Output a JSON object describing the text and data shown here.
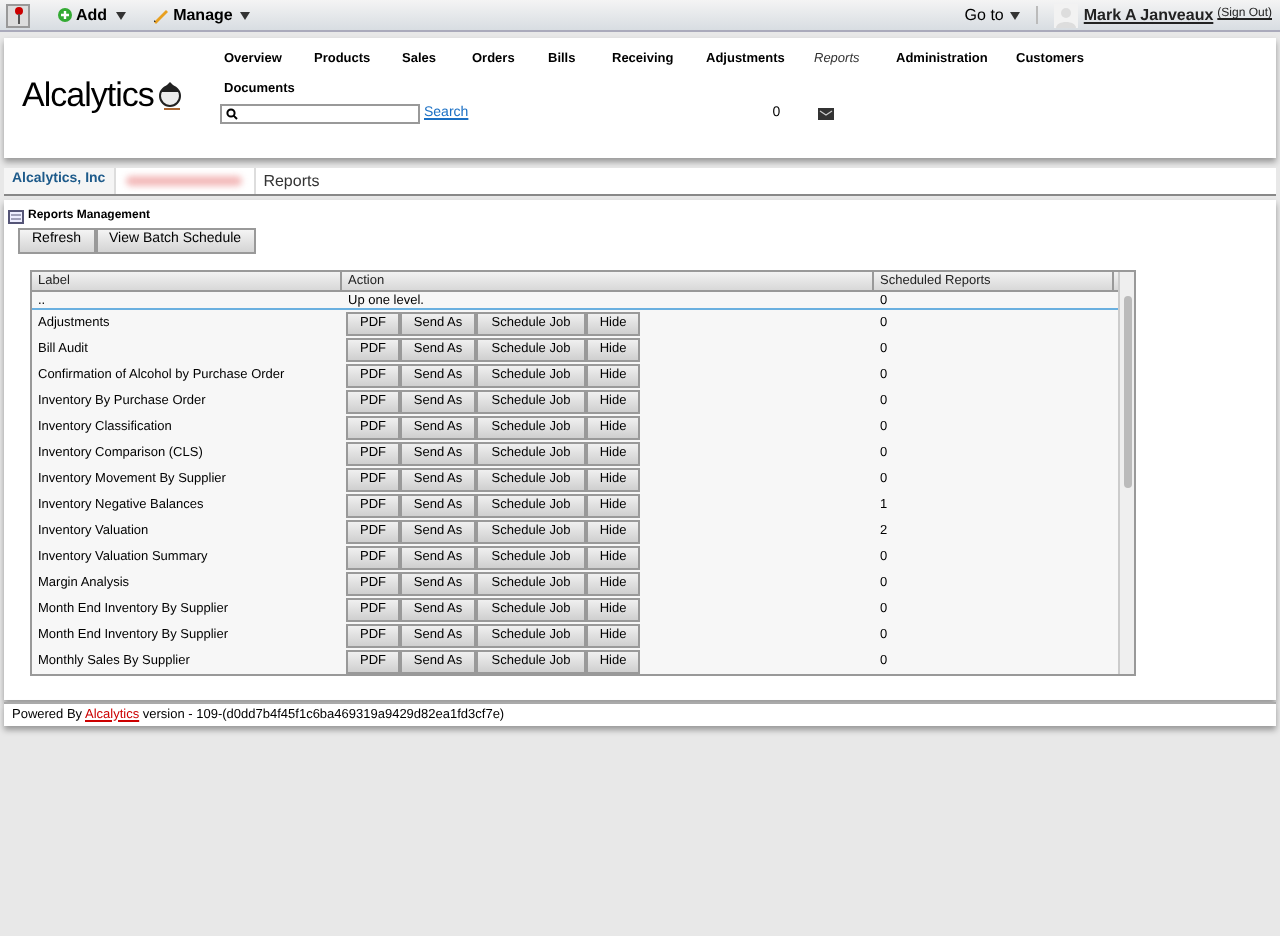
{
  "topbar": {
    "add": "Add",
    "manage": "Manage",
    "goto": "Go to",
    "user": "Mark A Janveaux",
    "sign_out": "(Sign Out)"
  },
  "header": {
    "logo": "Alcalytics",
    "search_link": "Search",
    "count": "0",
    "nav": [
      {
        "label": "Overview",
        "selected": false
      },
      {
        "label": "Products",
        "selected": false
      },
      {
        "label": "Sales",
        "selected": false
      },
      {
        "label": "Orders",
        "selected": false
      },
      {
        "label": "Bills",
        "selected": false
      },
      {
        "label": "Receiving",
        "selected": false
      },
      {
        "label": "Adjustments",
        "selected": false
      },
      {
        "label": "Reports",
        "selected": true
      },
      {
        "label": "Administration",
        "selected": false
      },
      {
        "label": "Customers",
        "selected": false
      },
      {
        "label": "Documents",
        "selected": false
      }
    ]
  },
  "breadcrumb": {
    "company": "Alcalytics, Inc",
    "current": "Reports"
  },
  "panel": {
    "title": "Reports Management",
    "buttons": [
      "Refresh",
      "View Batch Schedule"
    ]
  },
  "table": {
    "columns": [
      "Label",
      "Action",
      "Scheduled Reports"
    ],
    "up_row": {
      "label": "..",
      "action": "Up one level.",
      "count": "0"
    },
    "rows": [
      {
        "label": "Adjustments",
        "actions": [
          "PDF",
          "Send As",
          "Schedule Job",
          "Hide"
        ],
        "count": "0"
      },
      {
        "label": "Bill Audit",
        "actions": [
          "PDF",
          "Send As",
          "Schedule Job",
          "Hide"
        ],
        "count": "0"
      },
      {
        "label": "Confirmation of Alcohol by Purchase Order",
        "actions": [
          "PDF",
          "Send As",
          "Schedule Job",
          "Hide"
        ],
        "count": "0"
      },
      {
        "label": "Inventory By Purchase Order",
        "actions": [
          "PDF",
          "Send As",
          "Schedule Job",
          "Hide"
        ],
        "count": "0"
      },
      {
        "label": "Inventory Classification",
        "actions": [
          "PDF",
          "Send As",
          "Schedule Job",
          "Hide"
        ],
        "count": "0"
      },
      {
        "label": "Inventory Comparison (CLS)",
        "actions": [
          "PDF",
          "Send As",
          "Schedule Job",
          "Hide"
        ],
        "count": "0"
      },
      {
        "label": "Inventory Movement By Supplier",
        "actions": [
          "PDF",
          "Send As",
          "Schedule Job",
          "Hide"
        ],
        "count": "0"
      },
      {
        "label": "Inventory Negative Balances",
        "actions": [
          "PDF",
          "Send As",
          "Schedule Job",
          "Hide"
        ],
        "count": "1"
      },
      {
        "label": "Inventory Valuation",
        "actions": [
          "PDF",
          "Send As",
          "Schedule Job",
          "Hide"
        ],
        "count": "2"
      },
      {
        "label": "Inventory Valuation Summary",
        "actions": [
          "PDF",
          "Send As",
          "Schedule Job",
          "Hide"
        ],
        "count": "0"
      },
      {
        "label": "Margin Analysis",
        "actions": [
          "PDF",
          "Send As",
          "Schedule Job",
          "Hide"
        ],
        "count": "0"
      },
      {
        "label": "Month End Inventory By Supplier",
        "actions": [
          "PDF",
          "Send As",
          "Schedule Job",
          "Hide"
        ],
        "count": "0"
      },
      {
        "label": "Month End Inventory By Supplier",
        "actions": [
          "PDF",
          "Send As",
          "Schedule Job",
          "Hide"
        ],
        "count": "0"
      },
      {
        "label": "Monthly Sales By Supplier",
        "actions": [
          "PDF",
          "Send As",
          "Schedule Job",
          "Hide"
        ],
        "count": "0"
      }
    ]
  },
  "footer": {
    "prefix": "Powered By",
    "link": "Alcalytics",
    "suffix": "version - 109-(d0dd7b4f45f1c6ba469319a9429d82ea1fd3cf7e)"
  }
}
